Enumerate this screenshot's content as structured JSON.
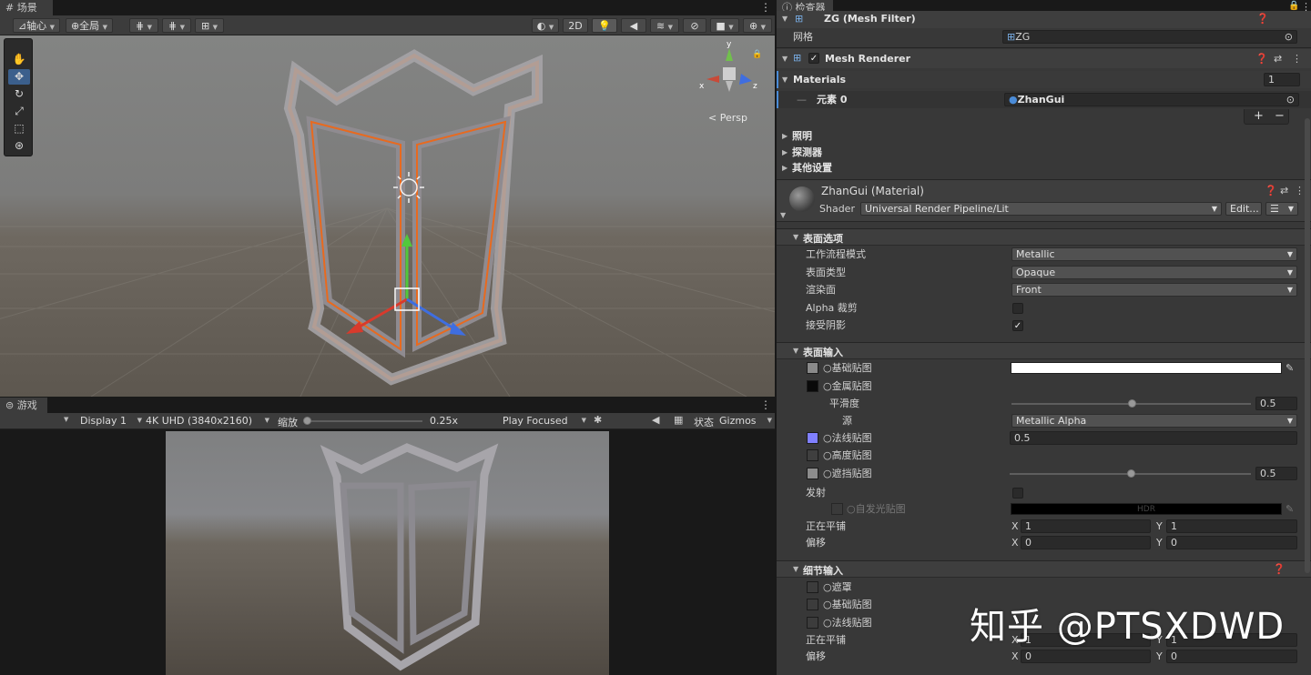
{
  "scene_tab": {
    "icon": "grid-icon",
    "label": "场景"
  },
  "scene_toolbar": {
    "pivot": "轴心",
    "global": "全局",
    "mode_2d": "2D"
  },
  "scene_view": {
    "persp": "Persp",
    "gizmo_axes": {
      "x": "x",
      "y": "y",
      "z": "z"
    }
  },
  "game_tab": {
    "icon": "gamepad-icon",
    "label": "游戏"
  },
  "game_toolbar": {
    "display": "Display 1",
    "resolution": "4K UHD (3840x2160)",
    "scale_label": "缩放",
    "scale_value": "0.25x",
    "scale_level": 0.0,
    "play_mode": "Play Focused",
    "stats": "状态",
    "gizmos": "Gizmos"
  },
  "inspector": {
    "tab_label": "检查器",
    "mesh_filter": {
      "title": "ZG (Mesh Filter)",
      "mesh_label": "网格",
      "mesh_value": "ZG"
    },
    "mesh_renderer": {
      "title": "Mesh Renderer",
      "enabled": true,
      "materials_label": "Materials",
      "materials_count": "1",
      "element_label": "元素 0",
      "element_value": "ZhanGui",
      "add": "+",
      "remove": "−",
      "lighting": "照明",
      "probes": "探测器",
      "other_settings": "其他设置"
    },
    "material": {
      "title": "ZhanGui (Material)",
      "shader_label": "Shader",
      "shader_value": "Universal Render Pipeline/Lit",
      "edit_button": "Edit..."
    },
    "surface_options": {
      "header": "表面选项",
      "workflow_label": "工作流程模式",
      "workflow_value": "Metallic",
      "surface_type_label": "表面类型",
      "surface_type_value": "Opaque",
      "render_face_label": "渲染面",
      "render_face_value": "Front",
      "alpha_clip_label": "Alpha 裁剪",
      "alpha_clip": false,
      "receive_shadows_label": "接受阴影",
      "receive_shadows": true
    },
    "surface_inputs": {
      "header": "表面输入",
      "base_map": "基础贴图",
      "metallic_map": "金属贴图",
      "smoothness_label": "平滑度",
      "smoothness_value": "0.5",
      "smoothness_level": 0.5,
      "source_label": "源",
      "source_value": "Metallic Alpha",
      "normal_map": "法线贴图",
      "normal_value": "0.5",
      "height_map": "高度贴图",
      "occlusion_map": "遮挡贴图",
      "occlusion_value": "0.5",
      "occlusion_level": 0.5,
      "emission_label": "发射",
      "emission": false,
      "emission_map": "自发光贴图",
      "hdr": "HDR",
      "tiling_label": "正在平铺",
      "tiling_x": "1",
      "tiling_y": "1",
      "offset_label": "偏移",
      "offset_x": "0",
      "offset_y": "0",
      "x": "X",
      "y": "Y"
    },
    "detail_inputs": {
      "header": "细节输入",
      "mask": "遮罩",
      "base_map": "基础贴图",
      "normal_map": "法线贴图",
      "tiling_label": "正在平铺",
      "tiling_x": "1",
      "tiling_y": "1",
      "offset_label": "偏移",
      "offset_x": "0",
      "offset_y": "0"
    }
  },
  "watermark": "知乎 @PTSXDWD",
  "colors": {
    "selection_outline": "#e86a1f",
    "accent_blue": "#4b8cd8",
    "normal_map_swatch": "#8080ff"
  }
}
